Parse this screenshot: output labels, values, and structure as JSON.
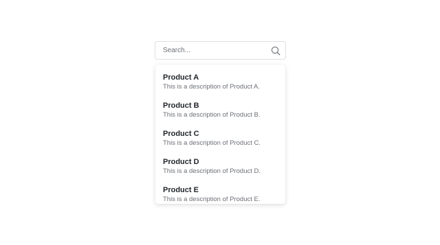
{
  "search": {
    "placeholder": "Search...",
    "value": "",
    "icon": "search-icon"
  },
  "results": {
    "items": [
      {
        "title": "Product A",
        "description": "This is a description of Product A."
      },
      {
        "title": "Product B",
        "description": "This is a description of Product B."
      },
      {
        "title": "Product C",
        "description": "This is a description of Product C."
      },
      {
        "title": "Product D",
        "description": "This is a description of Product D."
      },
      {
        "title": "Product E",
        "description": "This is a description of Product E."
      }
    ]
  },
  "colors": {
    "border": "#dcdfe3",
    "title_text": "#1f2328",
    "description_text": "#6b6f75",
    "background": "#ffffff"
  }
}
